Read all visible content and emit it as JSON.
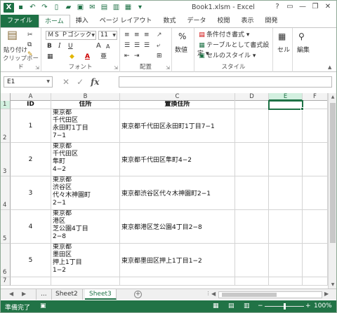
{
  "window": {
    "title": "Book1.xlsm - Excel",
    "qat_icons": [
      "excel-app",
      "save",
      "undo",
      "redo",
      "new",
      "open",
      "print-preview",
      "email",
      "quick-print",
      "format",
      "picture",
      "customize"
    ],
    "controls": [
      "?",
      "▭",
      "—",
      "❐",
      "✕"
    ]
  },
  "ribbon_tabs": [
    "ファイル",
    "ホーム",
    "挿入",
    "ページ レイアウト",
    "数式",
    "データ",
    "校閲",
    "表示",
    "開発"
  ],
  "active_tab": "ホーム",
  "ribbon": {
    "clipboard": {
      "label": "クリップボード",
      "paste": "貼り付け"
    },
    "font": {
      "label": "フォント",
      "name": "ＭＳ Ｐゴシック",
      "size": "11",
      "bold": "B",
      "italic": "I",
      "underline": "U",
      "grow": "A",
      "shrink": "A",
      "font_color": "A"
    },
    "alignment": {
      "label": "配置"
    },
    "number": {
      "label": "数値",
      "symbol": "%"
    },
    "styles": {
      "label": "スタイル",
      "conditional": "条件付き書式 ▾",
      "table": "テーブルとして書式設定 ▾",
      "cell_styles": "セルのスタイル ▾"
    },
    "cells": {
      "label": "セル"
    },
    "editing": {
      "label": "編集"
    }
  },
  "formula_bar": {
    "name_box": "E1",
    "cancel": "✕",
    "enter": "✓",
    "fx": "fx",
    "value": ""
  },
  "columns": [
    "A",
    "B",
    "C",
    "D",
    "E",
    "F"
  ],
  "rows": [
    "1",
    "2",
    "3",
    "4",
    "5",
    "6",
    "7"
  ],
  "headers": {
    "id": "ID",
    "address": "住所",
    "replaced": "置換住所"
  },
  "records": [
    {
      "id": "1",
      "address": "東京都\n千代田区\n永田町1丁目\n7−1",
      "replaced": "東京都千代田区永田町1丁目7−1"
    },
    {
      "id": "2",
      "address": "東京都\n千代田区\n隼町\n4−2",
      "replaced": "東京都千代田区隼町4−2"
    },
    {
      "id": "3",
      "address": "東京都\n渋谷区\n代々木神園町\n2−1",
      "replaced": "東京都渋谷区代々木神園町2−1"
    },
    {
      "id": "4",
      "address": "東京都\n港区\n芝公園4丁目\n2−8",
      "replaced": "東京都港区芝公園4丁目2−8"
    },
    {
      "id": "5",
      "address": "東京都\n墨田区\n押上1丁目\n1−2",
      "replaced": "東京都墨田区押上1丁目1−2"
    }
  ],
  "selected_cell": "E1",
  "sheet_tabs": {
    "ellipsis": "...",
    "tabs": [
      "Sheet2",
      "Sheet3"
    ],
    "active": "Sheet3",
    "add": "+"
  },
  "status": {
    "ready": "準備完了",
    "zoom": "100%",
    "minus": "−",
    "plus": "+"
  },
  "colors": {
    "accent": "#1e7145",
    "statusbar": "#217346"
  }
}
